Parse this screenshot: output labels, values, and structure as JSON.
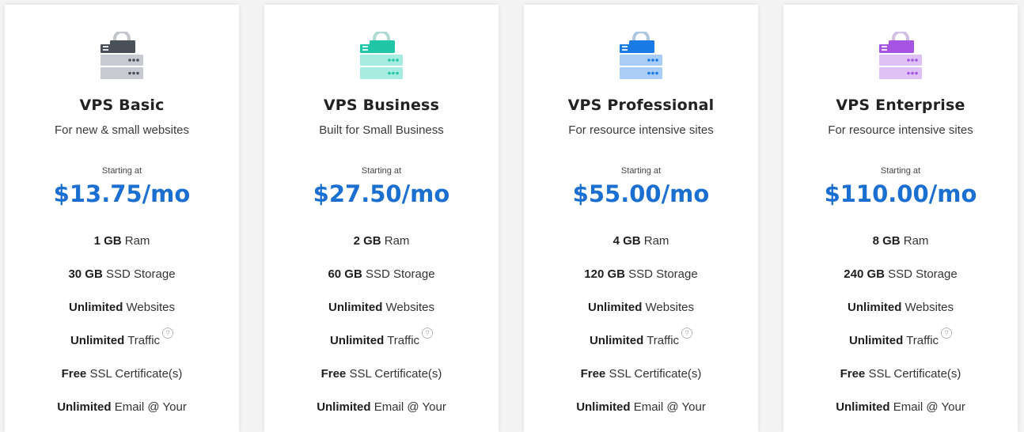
{
  "plans": [
    {
      "name": "VPS Basic",
      "subtitle": "For new & small websites",
      "starting_label": "Starting at",
      "price": "$13.75/mo",
      "accent": "#4a5059",
      "accent_light": "#c7cbd1",
      "icon": "server-lock-icon",
      "features": [
        {
          "bold": "1 GB",
          "text": "Ram"
        },
        {
          "bold": "30 GB",
          "text": "SSD Storage"
        },
        {
          "bold": "Unlimited",
          "text": "Websites"
        },
        {
          "bold": "Unlimited",
          "text": "Traffic",
          "help": "?"
        },
        {
          "bold": "Free",
          "text": "SSL Certificate(s)"
        },
        {
          "bold": "Unlimited",
          "text": "Email @ Your"
        }
      ]
    },
    {
      "name": "VPS Business",
      "subtitle": "Built for Small Business",
      "starting_label": "Starting at",
      "price": "$27.50/mo",
      "accent": "#1fc7a7",
      "accent_light": "#a7ece0",
      "icon": "server-lock-icon",
      "features": [
        {
          "bold": "2 GB",
          "text": "Ram"
        },
        {
          "bold": "60 GB",
          "text": "SSD Storage"
        },
        {
          "bold": "Unlimited",
          "text": "Websites"
        },
        {
          "bold": "Unlimited",
          "text": "Traffic",
          "help": "?"
        },
        {
          "bold": "Free",
          "text": "SSL Certificate(s)"
        },
        {
          "bold": "Unlimited",
          "text": "Email @ Your"
        }
      ]
    },
    {
      "name": "VPS Professional",
      "subtitle": "For resource intensive sites",
      "starting_label": "Starting at",
      "price": "$55.00/mo",
      "accent": "#1b7be6",
      "accent_light": "#a9cdf6",
      "icon": "server-lock-icon",
      "features": [
        {
          "bold": "4 GB",
          "text": "Ram"
        },
        {
          "bold": "120 GB",
          "text": "SSD Storage"
        },
        {
          "bold": "Unlimited",
          "text": "Websites"
        },
        {
          "bold": "Unlimited",
          "text": "Traffic",
          "help": "?"
        },
        {
          "bold": "Free",
          "text": "SSL Certificate(s)"
        },
        {
          "bold": "Unlimited",
          "text": "Email @ Your"
        }
      ]
    },
    {
      "name": "VPS Enterprise",
      "subtitle": "For resource intensive sites",
      "starting_label": "Starting at",
      "price": "$110.00/mo",
      "accent": "#a655e3",
      "accent_light": "#dfc1f5",
      "icon": "server-lock-icon",
      "features": [
        {
          "bold": "8 GB",
          "text": "Ram"
        },
        {
          "bold": "240 GB",
          "text": "SSD Storage"
        },
        {
          "bold": "Unlimited",
          "text": "Websites"
        },
        {
          "bold": "Unlimited",
          "text": "Traffic",
          "help": "?"
        },
        {
          "bold": "Free",
          "text": "SSL Certificate(s)"
        },
        {
          "bold": "Unlimited",
          "text": "Email @ Your"
        }
      ]
    }
  ]
}
